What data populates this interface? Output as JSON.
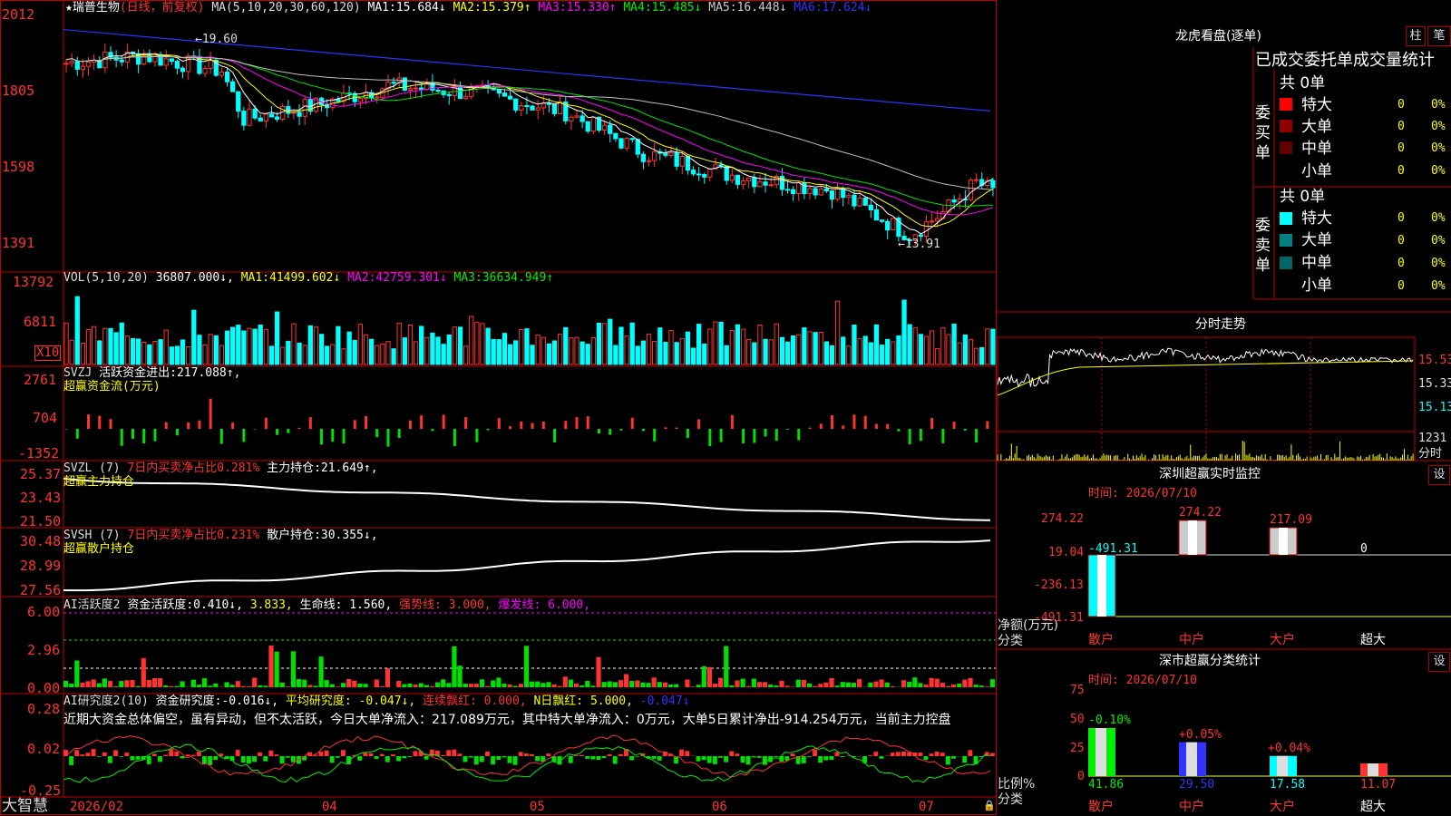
{
  "app_title": "大智慧",
  "stock": {
    "star": "★",
    "name": "瑞普生物",
    "mode": "(日线，前复权)"
  },
  "colors": {
    "up": "#ff3232",
    "down": "#00ffff",
    "grid": "#c00000",
    "ma1": "#ffffff",
    "ma2": "#ffff00",
    "ma3": "#ff00ff",
    "ma4": "#00e000",
    "ma5": "#c0c0c0",
    "ma6": "#3030ff"
  },
  "price_panel": {
    "ma_label": "MA(5,10,20,30,60,120)",
    "ma_values": [
      {
        "name": "MA1:",
        "value": "15.684↓"
      },
      {
        "name": "MA2:",
        "value": "15.379↑"
      },
      {
        "name": "MA3:",
        "value": "15.330↑"
      },
      {
        "name": "MA4:",
        "value": "15.485↓"
      },
      {
        "name": "MA5:",
        "value": "16.448↓"
      },
      {
        "name": "MA6:",
        "value": "17.624↓"
      }
    ],
    "yaxis": [
      "2012",
      "1805",
      "1598",
      "1391"
    ],
    "high_label": "←19.60",
    "low_label": "←13.91"
  },
  "vol_panel": {
    "label": "VOL(5,10,20)",
    "value": "36807.000↓",
    "ma": [
      {
        "name": "MA1:",
        "value": "41499.602↓"
      },
      {
        "name": "MA2:",
        "value": "42759.301↓"
      },
      {
        "name": "MA3:",
        "value": "36634.949↑"
      }
    ],
    "yaxis": [
      "13792",
      "6811"
    ],
    "unit": "X10"
  },
  "svzj_panel": {
    "label": "SVZJ",
    "text": "活跃资金进出:",
    "value": "217.088↑,",
    "subtitle": "超赢资金流(万元)",
    "yaxis": [
      "2761",
      "704",
      "-1352"
    ]
  },
  "svzl_panel": {
    "label": "SVZL (7)",
    "ratio": "7日内买卖净占比0.281%",
    "text": "主力持仓:",
    "value": "21.649↑,",
    "subtitle": "超赢主力持仓",
    "yaxis": [
      "25.37",
      "23.43",
      "21.50"
    ]
  },
  "svsh_panel": {
    "label": "SVSH (7)",
    "ratio": "7日内买卖净占比0.231%",
    "text": "散户持仓:",
    "value": "30.355↓,",
    "subtitle": "超赢散户持仓",
    "yaxis": [
      "30.48",
      "28.99",
      "27.56"
    ]
  },
  "ai_panel": {
    "label": "AI活跃度2",
    "text": "资金活跃度:",
    "v1": "0.410↓,",
    "v2": "3.833,",
    "life": "生命线: 1.560,",
    "strong": "强势线: 3.000,",
    "burst": "爆发线: 6.000,",
    "yaxis": [
      "6.00",
      "2.96",
      "0.00"
    ]
  },
  "research_panel": {
    "label": "AI研究度2(10)",
    "text": "资金研究度:",
    "v1": "-0.016↓,",
    "avg": "平均研究度: -0.047↓,",
    "red1": "连续飘红: 0.000,",
    "red2": "N日飘红: 5.000,",
    "v3": "-0.047↓",
    "comment": "近期大资金总体偏空，虽有异动，但不太活跃，今日大单净流入：217.089万元，其中特大单净流入：0万元，大单5日累计净出-914.254万元，当前主力控盘",
    "yaxis": [
      "0.28",
      "0.02",
      "-0.25"
    ]
  },
  "xaxis": [
    "2026/02",
    "04",
    "05",
    "06",
    "07"
  ],
  "right": {
    "longhu_title": "龙虎看盘(逐单)",
    "btn1": "柱",
    "btn2": "笔",
    "table_title": "已成交委托单成交量统计",
    "buy_label": "委买单",
    "sell_label": "委卖单",
    "buy_total": "共 0单",
    "sell_total": "共 0单",
    "rows": [
      {
        "label": "特大",
        "count": "0",
        "pct": "0%"
      },
      {
        "label": "大单",
        "count": "0",
        "pct": "0%"
      },
      {
        "label": "中单",
        "count": "0",
        "pct": "0%"
      },
      {
        "label": "小单",
        "count": "0",
        "pct": "0%"
      }
    ],
    "fenshi_title": "分时走势",
    "fenshi_yaxis": [
      "15.53",
      "15.33",
      "15.13"
    ],
    "fenshi_vol": "1231",
    "fenshi_vol_label": "分时",
    "szrt_title": "深圳超赢实时监控",
    "szrt_btn": "设",
    "szrt_time": "时间: 2026/07/10",
    "szrt_yaxis": [
      "274.22",
      "19.04",
      "-236.13",
      "-491.31"
    ],
    "szrt_unit": "净额(万元)",
    "szrt_cat_label": "分类",
    "szrt_cats": [
      "散户",
      "中户",
      "大户",
      "超大"
    ],
    "szrt_values": [
      "-491.31",
      "274.22",
      "217.09",
      "0"
    ],
    "szcl_title": "深市超赢分类统计",
    "szcl_btn": "设",
    "szcl_time": "时间: 2026/07/10",
    "szcl_yaxis": [
      "75",
      "50",
      "25",
      "0"
    ],
    "szcl_unit": "比例%",
    "szcl_cat_label": "分类",
    "szcl_cats": [
      "散户",
      "中户",
      "大户",
      "超大"
    ],
    "szcl_vals": [
      "41.86",
      "29.50",
      "17.58",
      "11.07"
    ],
    "szcl_chg": [
      "-0.10%",
      "+0.05%",
      "+0.04%",
      ""
    ]
  },
  "chart_data": [
    {
      "type": "candlestick",
      "title": "瑞普生物 (日线，前复权)",
      "ylim": [
        13.5,
        20.3
      ],
      "high": 19.6,
      "low": 13.91,
      "series": [
        {
          "name": "MA1",
          "value": 15.684
        },
        {
          "name": "MA2",
          "value": 15.379
        },
        {
          "name": "MA3",
          "value": 15.33
        },
        {
          "name": "MA4",
          "value": 15.485
        },
        {
          "name": "MA5",
          "value": 16.448
        },
        {
          "name": "MA6",
          "value": 17.624
        }
      ]
    },
    {
      "type": "bar",
      "title": "VOL(5,10,20)",
      "value": 36807.0,
      "ylim": [
        0,
        13792
      ]
    },
    {
      "type": "bar",
      "title": "SVZJ",
      "value": 217.088,
      "ylim": [
        -1352,
        2761
      ]
    },
    {
      "type": "line",
      "title": "SVZL (7)",
      "value": 21.649,
      "ylim": [
        21.5,
        25.37
      ]
    },
    {
      "type": "line",
      "title": "SVSH (7)",
      "value": 30.355,
      "ylim": [
        27.56,
        30.48
      ]
    },
    {
      "type": "bar",
      "title": "AI活跃度2",
      "value": 0.41,
      "ylim": [
        0,
        6
      ]
    },
    {
      "type": "bar",
      "title": "AI研究度2(10)",
      "value": -0.016,
      "ylim": [
        -0.25,
        0.28
      ]
    },
    {
      "type": "bar",
      "title": "深圳超赢实时监控",
      "categories": [
        "散户",
        "中户",
        "大户",
        "超大"
      ],
      "values": [
        -491.31,
        274.22,
        217.09,
        0
      ],
      "ylim": [
        -491.31,
        274.22
      ]
    },
    {
      "type": "bar",
      "title": "深市超赢分类统计",
      "categories": [
        "散户",
        "中户",
        "大户",
        "超大"
      ],
      "values": [
        41.86,
        29.5,
        17.58,
        11.07
      ],
      "ylim": [
        0,
        75
      ]
    }
  ]
}
